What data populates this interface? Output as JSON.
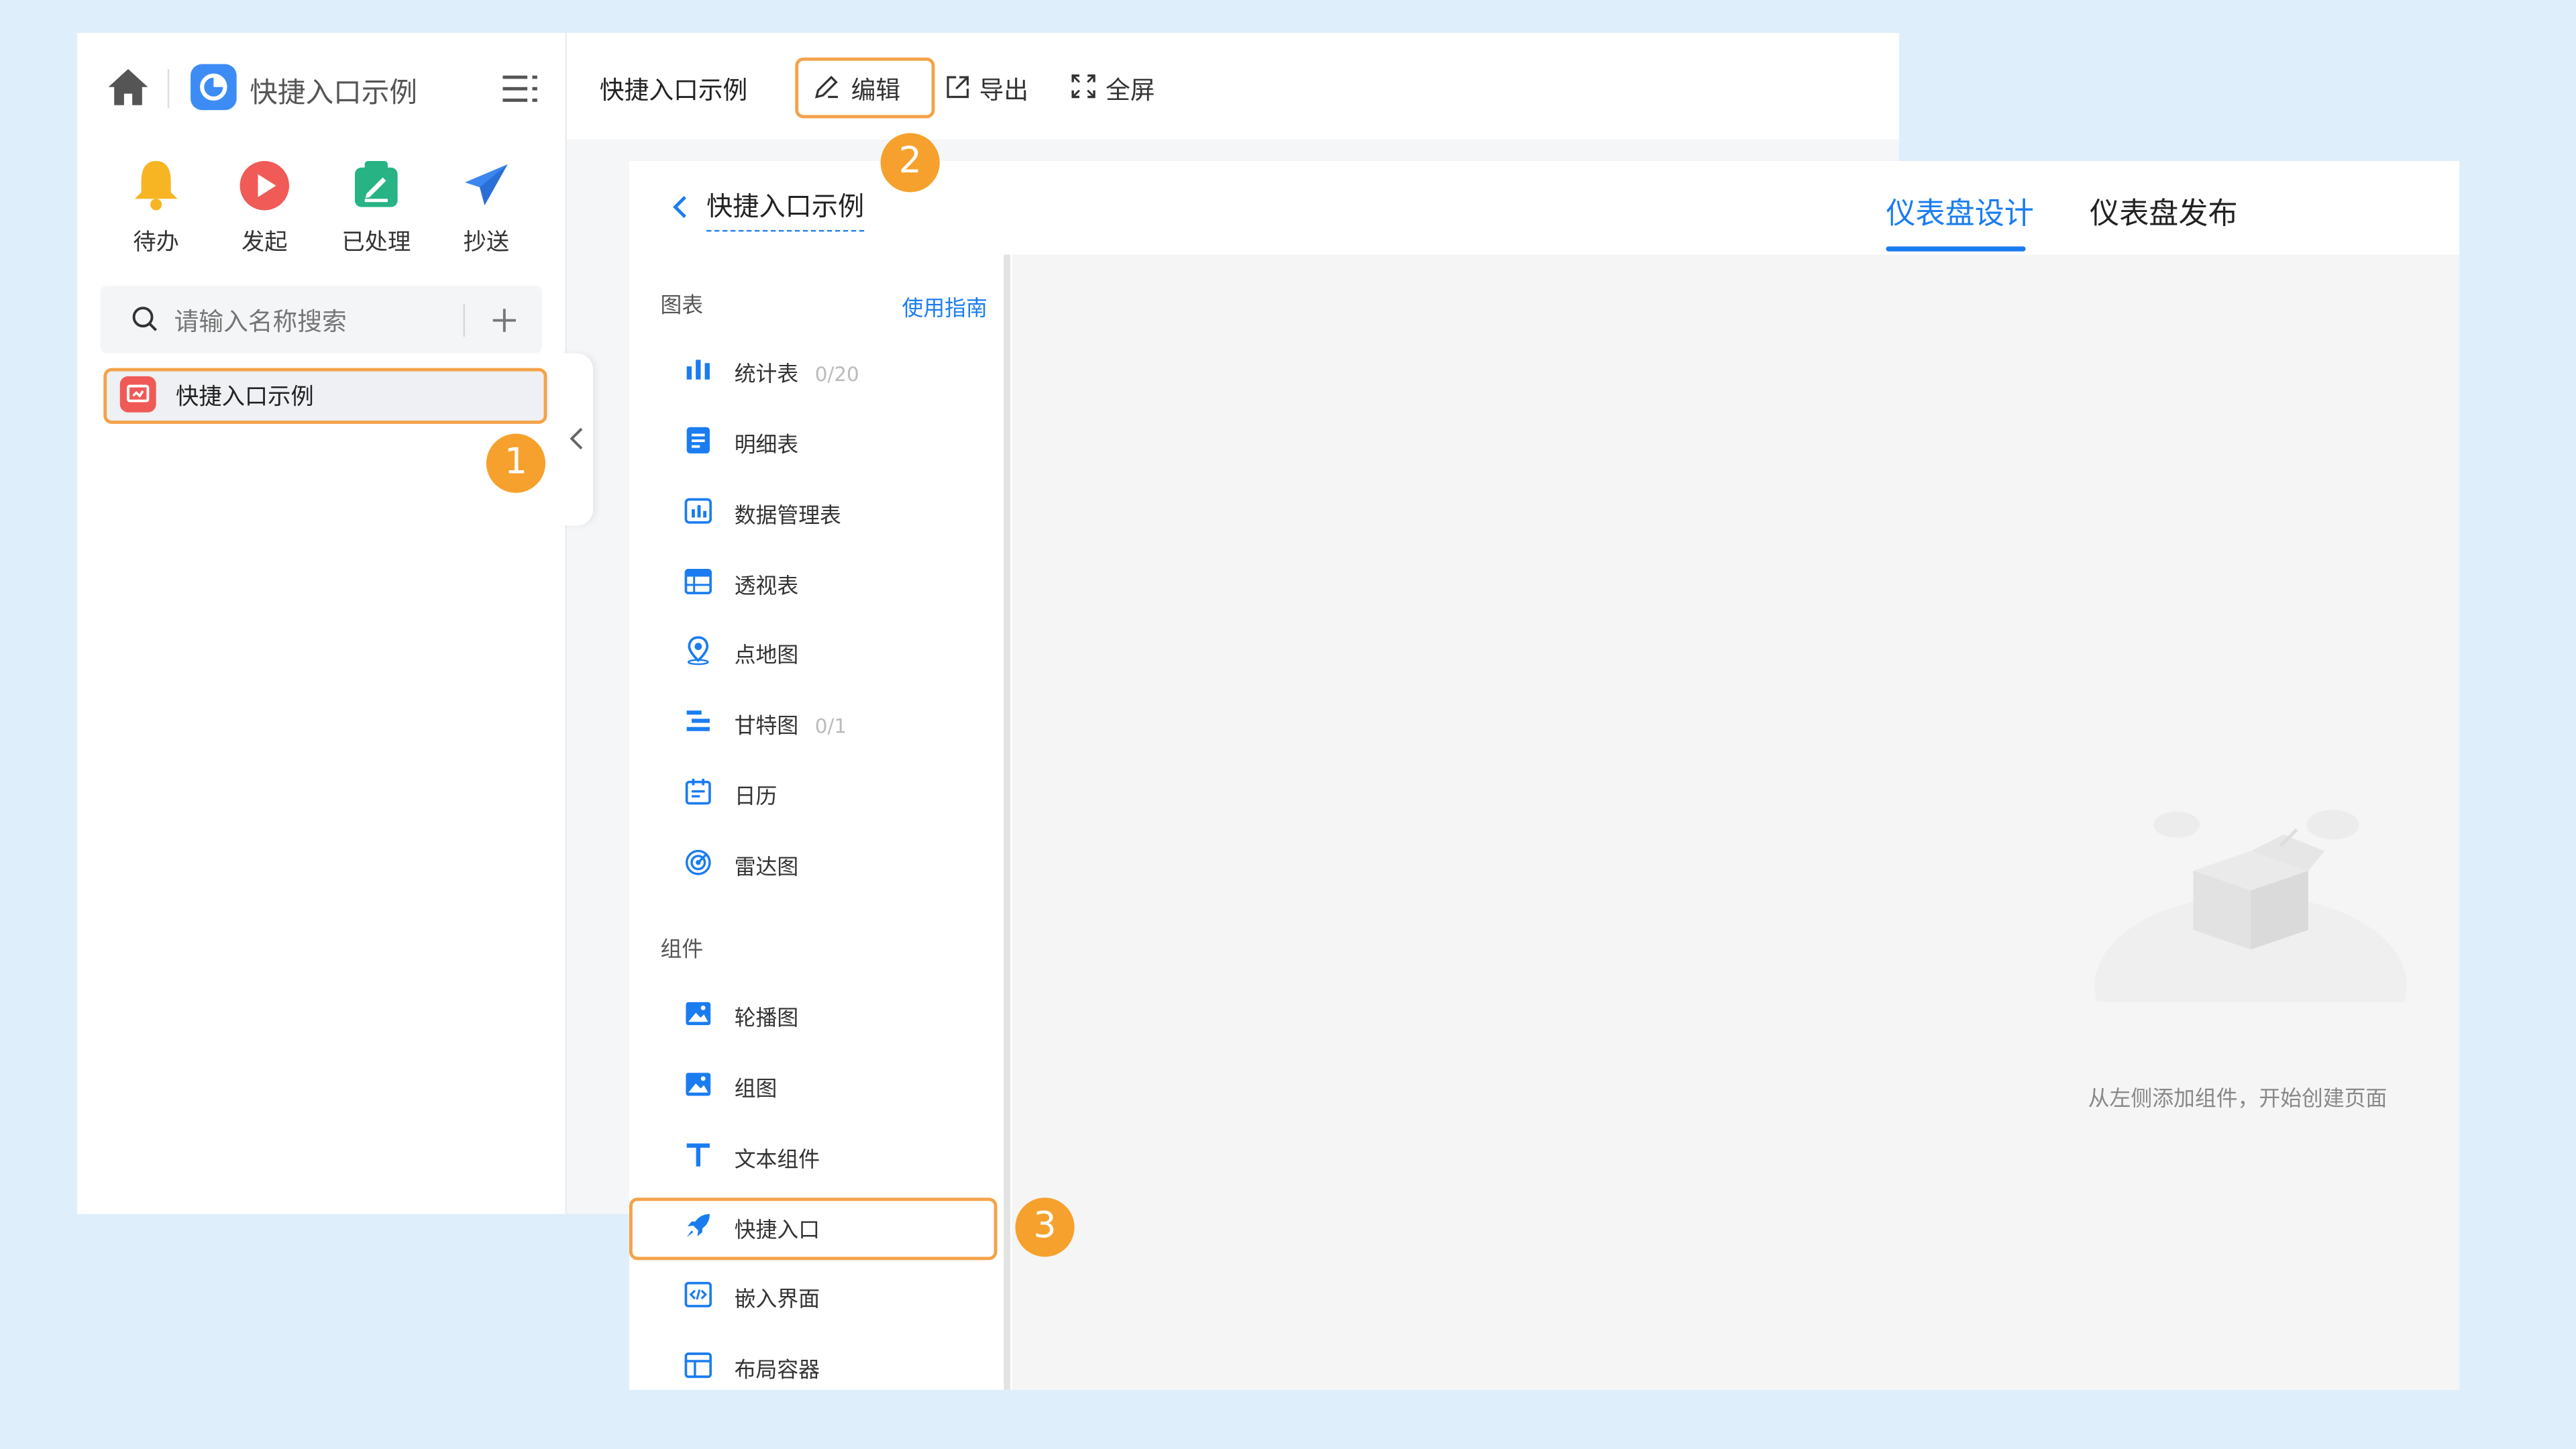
{
  "left_panel": {
    "app_title": "快捷入口示例",
    "quick_actions": [
      {
        "label": "待办",
        "icon": "bell-icon",
        "color": "#f7b524"
      },
      {
        "label": "发起",
        "icon": "play-icon",
        "color": "#f05a57"
      },
      {
        "label": "已处理",
        "icon": "processed-icon",
        "color": "#27b383"
      },
      {
        "label": "抄送",
        "icon": "send-icon",
        "color": "#3b86f0"
      }
    ],
    "search": {
      "placeholder": "请输入名称搜索"
    },
    "list_items": [
      {
        "label": "快捷入口示例"
      }
    ]
  },
  "main_header": {
    "title": "快捷入口示例",
    "edit_label": "编辑",
    "export_label": "导出",
    "fullscreen_label": "全屏"
  },
  "designer": {
    "back_title": "快捷入口示例",
    "tabs": [
      {
        "label": "仪表盘设计",
        "active": true
      },
      {
        "label": "仪表盘发布",
        "active": false
      }
    ],
    "charts_section": {
      "title": "图表",
      "guide_link": "使用指南"
    },
    "chart_items": [
      {
        "label": "统计表",
        "count": "0/20",
        "icon": "bar-chart-icon"
      },
      {
        "label": "明细表",
        "count": "",
        "icon": "detail-table-icon"
      },
      {
        "label": "数据管理表",
        "count": "",
        "icon": "data-table-icon"
      },
      {
        "label": "透视表",
        "count": "",
        "icon": "pivot-table-icon"
      },
      {
        "label": "点地图",
        "count": "",
        "icon": "map-pin-icon"
      },
      {
        "label": "甘特图",
        "count": "0/1",
        "icon": "gantt-icon"
      },
      {
        "label": "日历",
        "count": "",
        "icon": "calendar-icon"
      },
      {
        "label": "雷达图",
        "count": "",
        "icon": "radar-icon"
      }
    ],
    "components_section": {
      "title": "组件"
    },
    "component_items": [
      {
        "label": "轮播图",
        "icon": "carousel-image-icon"
      },
      {
        "label": "组图",
        "icon": "image-group-icon"
      },
      {
        "label": "文本组件",
        "icon": "text-icon"
      },
      {
        "label": "快捷入口",
        "icon": "rocket-icon"
      },
      {
        "label": "嵌入界面",
        "icon": "embed-code-icon"
      },
      {
        "label": "布局容器",
        "icon": "layout-container-icon"
      }
    ],
    "empty_state_text": "从左侧添加组件，开始创建页面"
  },
  "annotations": {
    "badge1": "1",
    "badge2": "2",
    "badge3": "3"
  },
  "colors": {
    "accent": "#1a7cf0",
    "highlight": "#f3a34a",
    "badge": "#f6a12d"
  }
}
